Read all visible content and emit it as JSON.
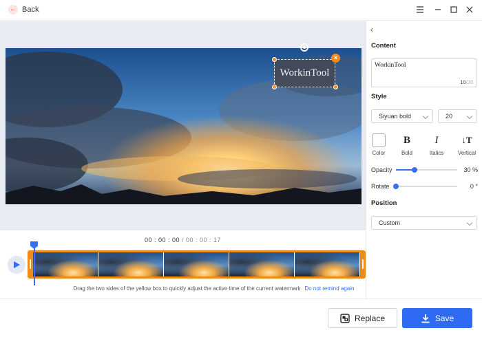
{
  "header": {
    "back_label": "Back",
    "icons": [
      "back-arrow-icon",
      "menu-icon",
      "minimize-icon",
      "maximize-icon",
      "close-icon"
    ]
  },
  "preview": {
    "watermark_text": "WorkinTool"
  },
  "timeline": {
    "current_time": "00 : 00 : 00",
    "separator": " / ",
    "total_time": "00 : 00 : 17",
    "tip": "Drag the two sides of the yellow box to quickly adjust the active time of the current watermark",
    "tip_link": "Do not remind again",
    "frame_count": 5
  },
  "panel": {
    "content_title": "Content",
    "content_value": "WorkinTool",
    "char_count": "10",
    "char_max": "/20",
    "style_title": "Style",
    "font_family": "Siyuan bold",
    "font_size": "20",
    "tools": {
      "color": "Color",
      "bold": "Bold",
      "italics": "Italics",
      "vertical": "Vertical"
    },
    "opacity_label": "Opacity",
    "opacity_value": "30",
    "opacity_unit": "%",
    "rotate_label": "Rotate",
    "rotate_value": "0",
    "rotate_unit": "°",
    "position_title": "Position",
    "position_value": "Custom"
  },
  "footer": {
    "replace_label": "Replace",
    "save_label": "Save"
  },
  "colors": {
    "accent": "#2f6bf2",
    "timeline_track": "#f08a17",
    "handle": "#f28c1c"
  },
  "levels": {
    "opacity_fraction": 0.3,
    "rotate_fraction": 0.0
  }
}
